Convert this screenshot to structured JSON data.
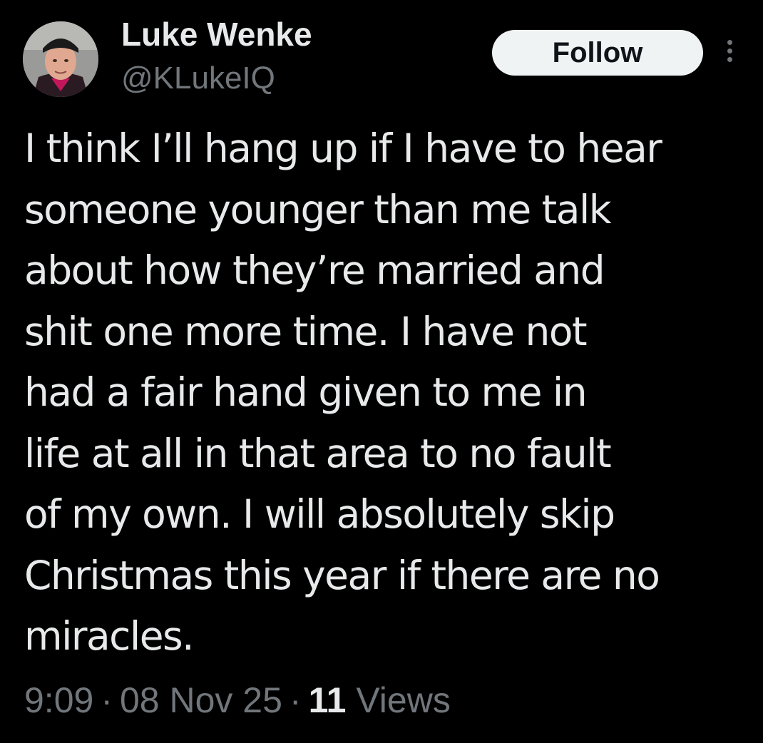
{
  "author": {
    "display_name": "Luke Wenke",
    "handle": "@KLukeIQ",
    "avatar_icon": "profile-photo"
  },
  "actions": {
    "follow_label": "Follow",
    "more_icon": "vertical-ellipsis-icon"
  },
  "tweet": {
    "lines": [
      "I think I’ll hang up if I have to hear",
      "someone younger than me talk",
      "about how they’re married and",
      "shit one more time.  I have not",
      "had a fair hand given to me in",
      "life at all in that area to no fault",
      "of my own.  I will absolutely skip",
      "Christmas this year if there are no",
      "miracles."
    ]
  },
  "meta": {
    "time": "9:09",
    "date": "08 Nov 25",
    "separator": "·",
    "views_count": "11",
    "views_label": "Views"
  },
  "colors": {
    "background": "#000000",
    "primary_text": "#e7e9ea",
    "secondary_text": "#71767b",
    "follow_bg": "#eff3f4",
    "follow_text": "#0f1419"
  }
}
